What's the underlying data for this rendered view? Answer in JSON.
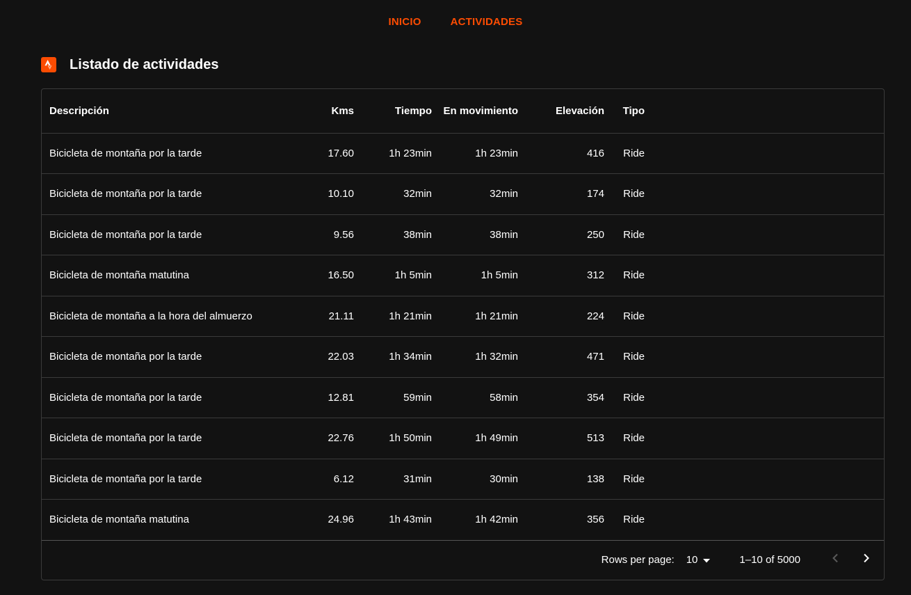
{
  "nav": {
    "items": [
      {
        "label": "INICIO"
      },
      {
        "label": "ACTIVIDADES"
      }
    ]
  },
  "page": {
    "title": "Listado de actividades",
    "icon": "strava-logo-icon",
    "accent_color": "#fc4c02"
  },
  "table": {
    "columns": [
      "Descripción",
      "Kms",
      "Tiempo",
      "En movimiento",
      "Elevación",
      "Tipo"
    ],
    "rows": [
      [
        "Bicicleta de montaña por la tarde",
        "17.60",
        "1h 23min",
        "1h 23min",
        "416",
        "Ride"
      ],
      [
        "Bicicleta de montaña por la tarde",
        "10.10",
        "32min",
        "32min",
        "174",
        "Ride"
      ],
      [
        "Bicicleta de montaña por la tarde",
        "9.56",
        "38min",
        "38min",
        "250",
        "Ride"
      ],
      [
        "Bicicleta de montaña matutina",
        "16.50",
        "1h 5min",
        "1h 5min",
        "312",
        "Ride"
      ],
      [
        "Bicicleta de montaña a la hora del almuerzo",
        "21.11",
        "1h 21min",
        "1h 21min",
        "224",
        "Ride"
      ],
      [
        "Bicicleta de montaña por la tarde",
        "22.03",
        "1h 34min",
        "1h 32min",
        "471",
        "Ride"
      ],
      [
        "Bicicleta de montaña por la tarde",
        "12.81",
        "59min",
        "58min",
        "354",
        "Ride"
      ],
      [
        "Bicicleta de montaña por la tarde",
        "22.76",
        "1h 50min",
        "1h 49min",
        "513",
        "Ride"
      ],
      [
        "Bicicleta de montaña por la tarde",
        "6.12",
        "31min",
        "30min",
        "138",
        "Ride"
      ],
      [
        "Bicicleta de montaña matutina",
        "24.96",
        "1h 43min",
        "1h 42min",
        "356",
        "Ride"
      ]
    ]
  },
  "pagination": {
    "rows_per_page_label": "Rows per page:",
    "rows_per_page_value": "10",
    "range_text": "1–10 of 5000",
    "prev_icon": "chevron-left-icon",
    "next_icon": "chevron-right-icon",
    "prev_disabled_color": "#5a5a5a"
  }
}
